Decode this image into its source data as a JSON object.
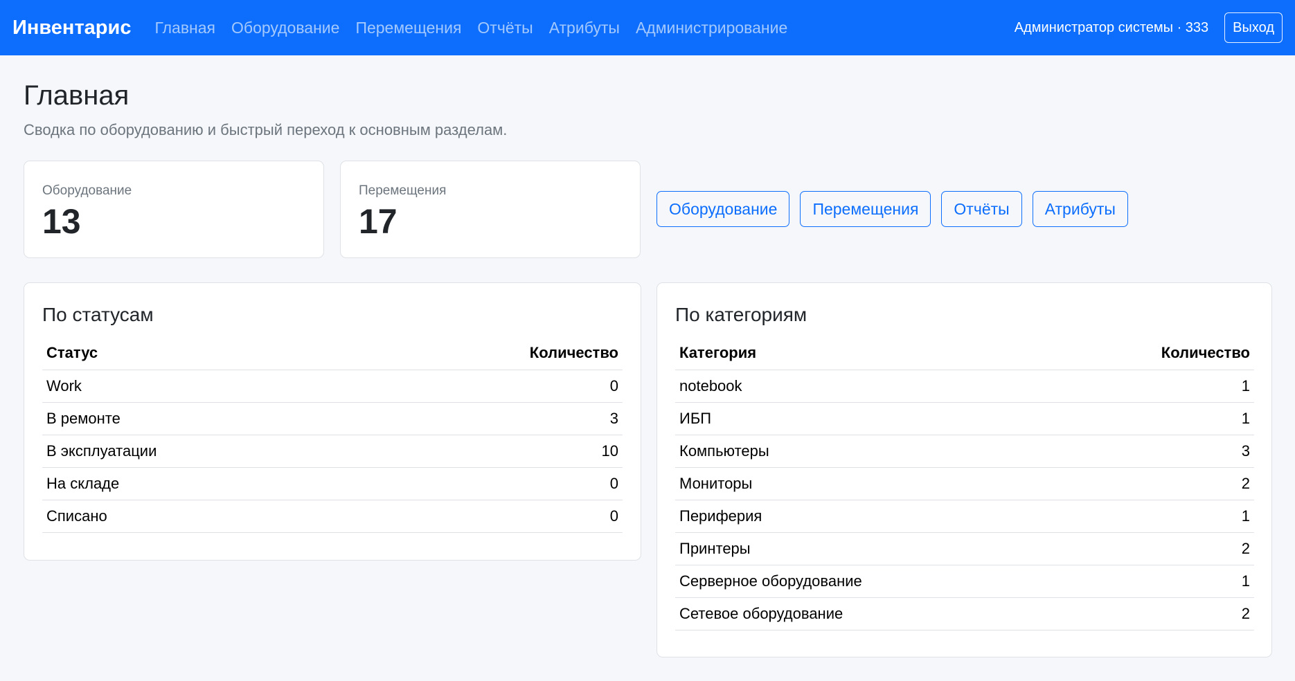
{
  "navbar": {
    "brand": "Инвентарис",
    "links": [
      "Главная",
      "Оборудование",
      "Перемещения",
      "Отчёты",
      "Атрибуты",
      "Администрирование"
    ],
    "user": "Администратор системы · 333",
    "logout_label": "Выход"
  },
  "header": {
    "title": "Главная",
    "subtitle": "Сводка по оборудованию и быстрый переход к основным разделам."
  },
  "stats": [
    {
      "label": "Оборудование",
      "value": "13"
    },
    {
      "label": "Перемещения",
      "value": "17"
    }
  ],
  "quick_links": [
    "Оборудование",
    "Перемещения",
    "Отчёты",
    "Атрибуты"
  ],
  "status_table": {
    "title": "По статусам",
    "columns": [
      "Статус",
      "Количество"
    ],
    "rows": [
      [
        "Work",
        "0"
      ],
      [
        "В ремонте",
        "3"
      ],
      [
        "В эксплуатации",
        "10"
      ],
      [
        "На складе",
        "0"
      ],
      [
        "Списано",
        "0"
      ]
    ]
  },
  "category_table": {
    "title": "По категориям",
    "columns": [
      "Категория",
      "Количество"
    ],
    "rows": [
      [
        "notebook",
        "1"
      ],
      [
        "ИБП",
        "1"
      ],
      [
        "Компьютеры",
        "3"
      ],
      [
        "Мониторы",
        "2"
      ],
      [
        "Периферия",
        "1"
      ],
      [
        "Принтеры",
        "2"
      ],
      [
        "Серверное оборудование",
        "1"
      ],
      [
        "Сетевое оборудование",
        "2"
      ]
    ]
  },
  "colors": {
    "primary": "#0d6efd",
    "page_background": "#f5f7fa",
    "muted_text": "#6c757d",
    "border": "#dee2e6"
  }
}
